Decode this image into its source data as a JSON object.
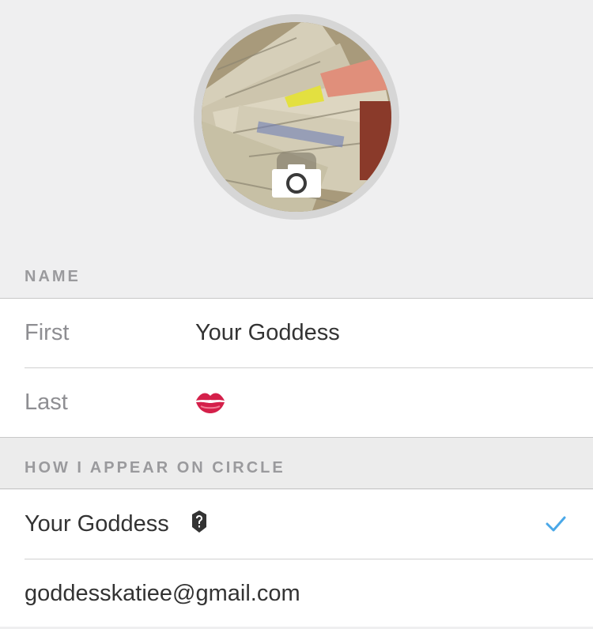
{
  "avatar": {
    "photo_icon": "money-photo",
    "camera_icon": "camera-icon"
  },
  "name_section": {
    "header": "NAME",
    "fields": [
      {
        "label": "First",
        "value": "Your Goddess"
      },
      {
        "label": "Last",
        "value": "💋",
        "icon": "kiss-lips-icon"
      }
    ]
  },
  "appear_section": {
    "header": "HOW I APPEAR ON CIRCLE",
    "options": [
      {
        "label": "Your Goddess",
        "badge_icon": "verified-badge-icon",
        "selected": true
      },
      {
        "label": "goddesskatiee@gmail.com",
        "selected": false
      }
    ]
  },
  "colors": {
    "background": "#efeff0",
    "checkmark": "#4aa8e8",
    "lips": "#d4204a"
  }
}
